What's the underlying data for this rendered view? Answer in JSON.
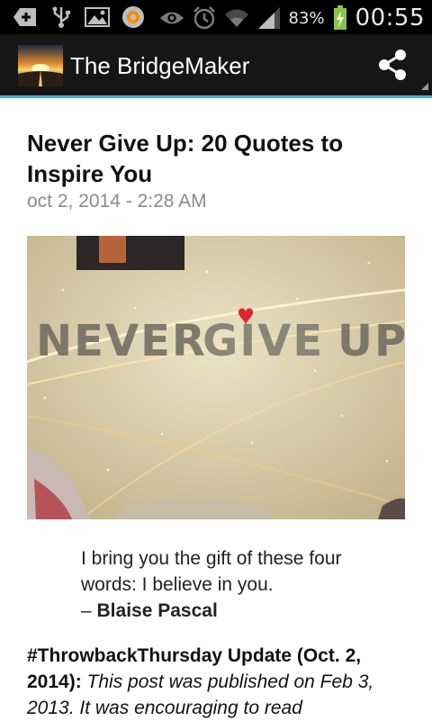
{
  "status_bar": {
    "battery_percent": "83%",
    "time": "00:55",
    "icons": [
      "add-notification-icon",
      "usb-icon",
      "gallery-icon",
      "app-notification-icon",
      "eye-icon",
      "alarm-icon",
      "wifi-icon",
      "signal-icon",
      "battery-charging-icon"
    ]
  },
  "action_bar": {
    "title": "The BridgeMaker",
    "share_icon": "share-icon",
    "accent_color": "#33b5e5"
  },
  "article": {
    "title": "Never Give Up: 20 Quotes to Inspire You",
    "date": "oct 2, 2014 - 2:28 AM",
    "hero_image_text": "NEVER GIVE UP",
    "quote_text": "I bring you the gift of these four words: I believe in you.",
    "quote_dash": "– ",
    "quote_author": "Blaise Pascal",
    "update_lead": "#ThrowbackThursday Update (Oct. 2, 2014):",
    "update_body": " This post was published on Feb 3, 2013. It was encouraging to read"
  }
}
